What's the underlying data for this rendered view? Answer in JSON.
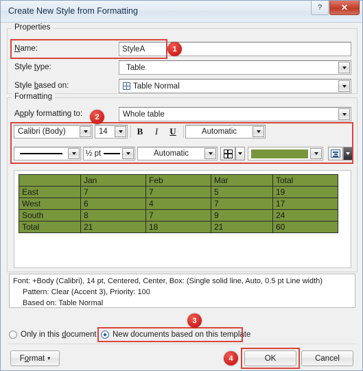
{
  "window": {
    "title": "Create New Style from Formatting",
    "help_label": "?",
    "close_label": "✕"
  },
  "properties": {
    "group_label": "Properties",
    "name_label": "Name:",
    "name_value": "StyleA",
    "style_type_label": "Style type:",
    "style_type_value": "Table",
    "style_based_on_label": "Style based on:",
    "style_based_on_value": "Table Normal"
  },
  "formatting": {
    "group_label": "Formatting",
    "apply_to_label": "Apply formatting to:",
    "apply_to_value": "Whole table",
    "font_family": "Calibri (Body)",
    "font_size": "14",
    "bold_label": "B",
    "italic_label": "I",
    "underline_label": "U",
    "font_color": "Automatic",
    "border_style_label": "",
    "border_width": "½ pt",
    "border_color": "Automatic",
    "shading_color_hex": "#78963c"
  },
  "preview": {
    "table": {
      "headers": [
        "",
        "Jan",
        "Feb",
        "Mar",
        "Total"
      ],
      "rows": [
        [
          "East",
          "7",
          "7",
          "5",
          "19"
        ],
        [
          "West",
          "6",
          "4",
          "7",
          "17"
        ],
        [
          "South",
          "8",
          "7",
          "9",
          "24"
        ],
        [
          "Total",
          "21",
          "18",
          "21",
          "60"
        ]
      ]
    }
  },
  "description": {
    "line1": "Font: +Body (Calibri), 14 pt, Centered, Center, Box: (Single solid line, Auto,  0.5 pt Line width)",
    "line2": "Pattern: Clear (Accent 3), Priority: 100",
    "line3": "Based on: Table Normal"
  },
  "scope": {
    "only_this_document": "Only in this document",
    "new_documents": "New documents based on this template"
  },
  "buttons": {
    "format": "Format",
    "format_caret": "▾",
    "ok": "OK",
    "cancel": "Cancel"
  },
  "annotations": {
    "badge1": "1",
    "badge2": "2",
    "badge3": "3",
    "badge4": "4",
    "accent_hex": "#d9453a"
  }
}
